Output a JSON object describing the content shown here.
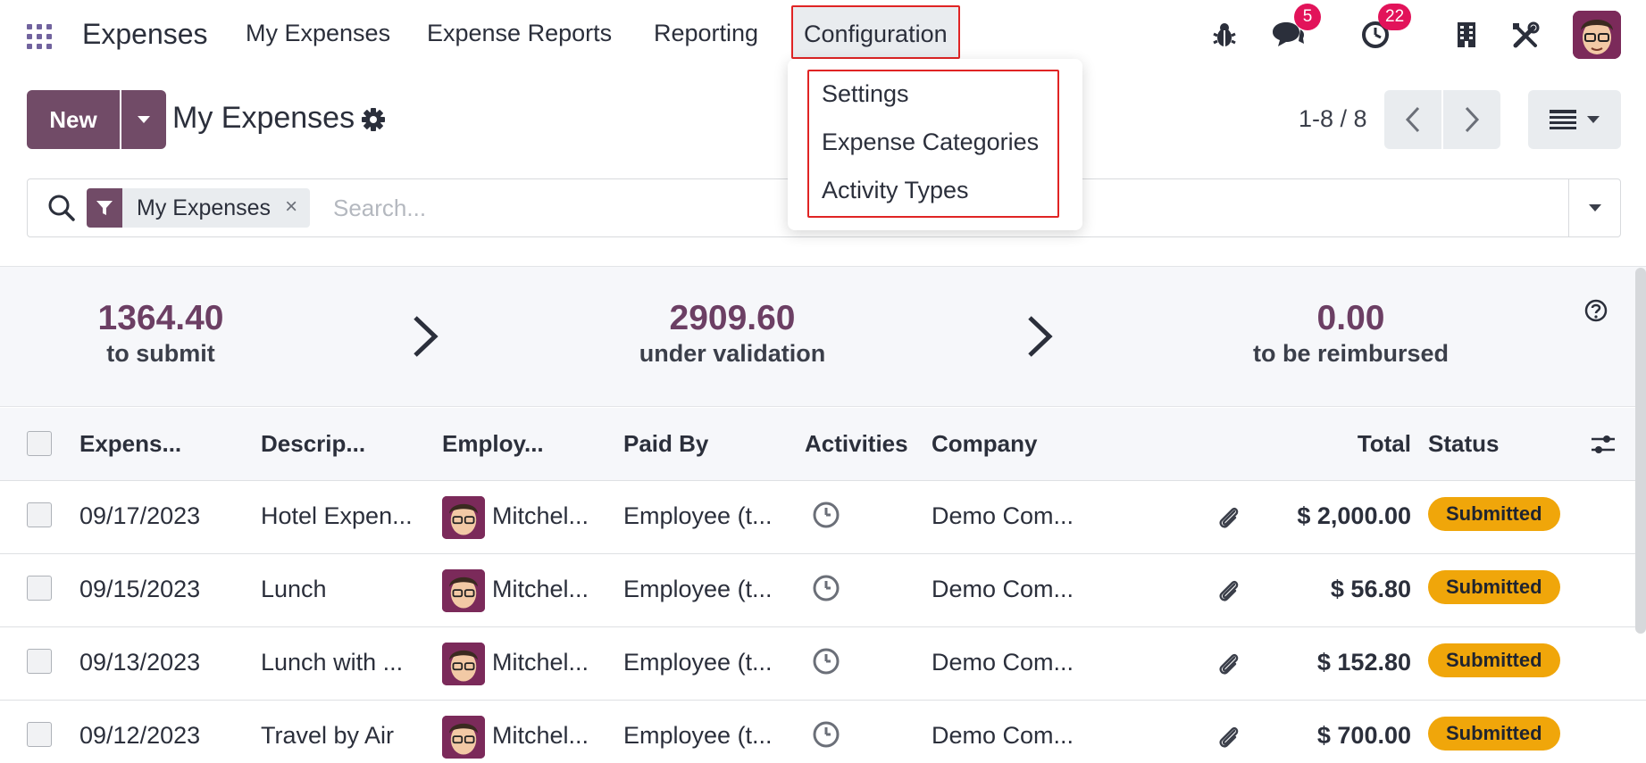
{
  "app": {
    "title": "Expenses"
  },
  "nav": {
    "items": [
      {
        "label": "My Expenses"
      },
      {
        "label": "Expense Reports"
      },
      {
        "label": "Reporting"
      },
      {
        "label": "Configuration"
      }
    ]
  },
  "systray": {
    "bug_icon": "bug-icon",
    "messages_count": "5",
    "activities_count": "22"
  },
  "configuration_menu": {
    "items": [
      {
        "label": "Settings"
      },
      {
        "label": "Expense Categories"
      },
      {
        "label": "Activity Types"
      }
    ]
  },
  "control": {
    "new_label": "New",
    "page_title": "My Expenses",
    "pager": "1-8 / 8"
  },
  "search": {
    "facet_label": "My Expenses",
    "facet_remove": "×",
    "placeholder": "Search..."
  },
  "summary": [
    {
      "value": "1364.40",
      "label": "to submit"
    },
    {
      "value": "2909.60",
      "label": "under validation"
    },
    {
      "value": "0.00",
      "label": "to be reimbursed"
    }
  ],
  "table": {
    "columns": {
      "expense_date": "Expens...",
      "description": "Descrip...",
      "employee": "Employ...",
      "paid_by": "Paid By",
      "activities": "Activities",
      "company": "Company",
      "total": "Total",
      "status": "Status"
    },
    "rows": [
      {
        "date": "09/17/2023",
        "description": "Hotel Expen...",
        "employee": "Mitchel...",
        "paid_by": "Employee (t...",
        "company": "Demo Com...",
        "total": "$ 2,000.00",
        "status": "Submitted"
      },
      {
        "date": "09/15/2023",
        "description": "Lunch",
        "employee": "Mitchel...",
        "paid_by": "Employee (t...",
        "company": "Demo Com...",
        "total": "$ 56.80",
        "status": "Submitted"
      },
      {
        "date": "09/13/2023",
        "description": "Lunch with ...",
        "employee": "Mitchel...",
        "paid_by": "Employee (t...",
        "company": "Demo Com...",
        "total": "$ 152.80",
        "status": "Submitted"
      },
      {
        "date": "09/12/2023",
        "description": "Travel by Air",
        "employee": "Mitchel...",
        "paid_by": "Employee (t...",
        "company": "Demo Com...",
        "total": "$ 700.00",
        "status": "Submitted"
      }
    ]
  },
  "colors": {
    "brand": "#714b67",
    "status_submitted": "#f0a60a",
    "badge": "#e2135a",
    "highlight": "#e02424"
  }
}
